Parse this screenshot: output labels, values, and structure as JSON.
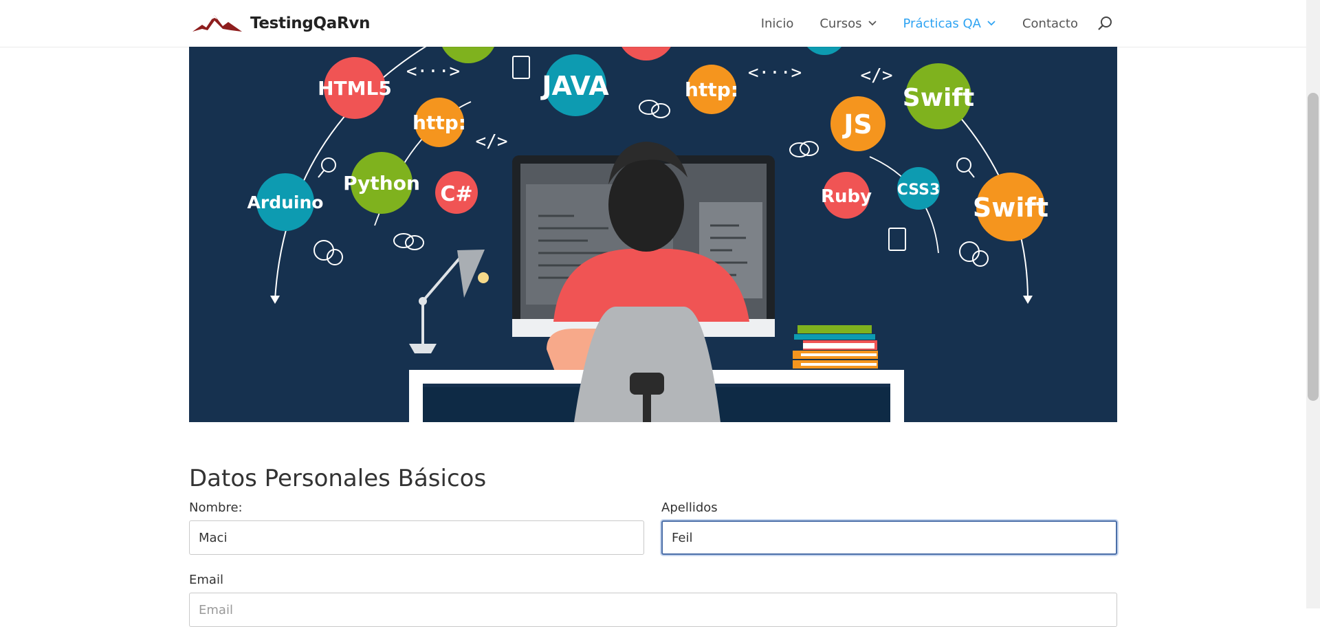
{
  "brand": {
    "name": "TestingQaRvn"
  },
  "nav": {
    "items": [
      {
        "label": "Inicio",
        "dropdown": false,
        "active": false
      },
      {
        "label": "Cursos",
        "dropdown": true,
        "active": false
      },
      {
        "label": "Prácticas QA",
        "dropdown": true,
        "active": true
      },
      {
        "label": "Contacto",
        "dropdown": false,
        "active": false
      }
    ],
    "search_icon": "search-icon",
    "active_color": "#2ea3f2"
  },
  "hero": {
    "background_color": "#16314f",
    "badges": [
      "HTML5",
      "JAVA",
      "http:",
      "Swift",
      "http:",
      "JS",
      "Python",
      "C#",
      "Arduino",
      "Ruby",
      "CSS3",
      "Swift"
    ],
    "code_symbols": [
      "<···>",
      "</>",
      "<···>",
      "</>",
      "</>"
    ]
  },
  "form": {
    "title": "Datos Personales Básicos",
    "nombre": {
      "label": "Nombre:",
      "value": "Maci"
    },
    "apellidos": {
      "label": "Apellidos",
      "value": "Feil"
    },
    "email": {
      "label": "Email",
      "placeholder": "Email",
      "value": ""
    }
  }
}
